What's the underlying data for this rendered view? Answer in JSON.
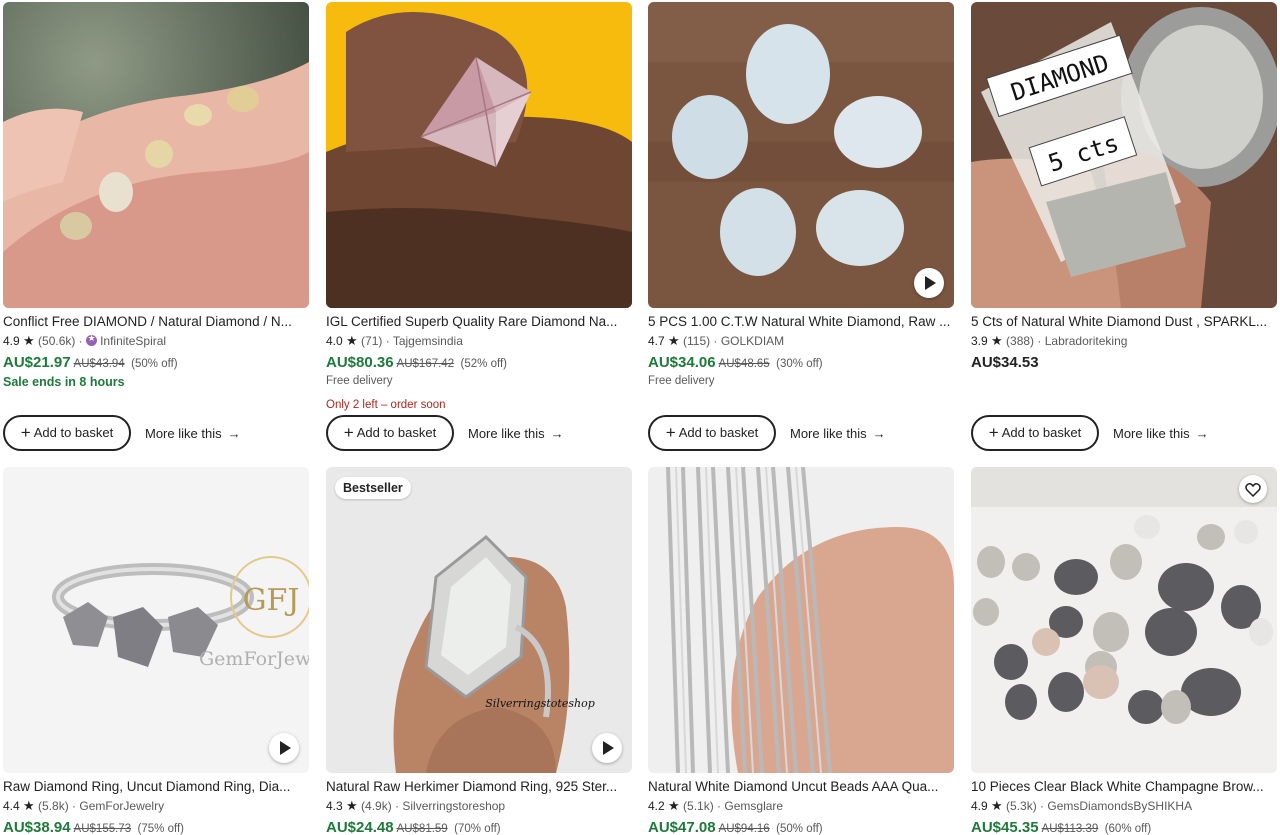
{
  "buttons": {
    "add_to_basket": "Add to basket",
    "more_like_this": "More like this"
  },
  "colors": {
    "price_sale": "#1e7a3a",
    "low_stock": "#b3261e",
    "star_seller": "#9560b8"
  },
  "listings": [
    {
      "title": "Conflict Free DIAMOND / Natural Diamond / N...",
      "rating": "4.9",
      "reviews": "(50.6k)",
      "shop": "InfiniteSpiral",
      "star_seller": true,
      "price": "AU$21.97",
      "original_price": "AU$43.94",
      "discount": "(50% off)",
      "note": "Sale ends in 8 hours"
    },
    {
      "title": "IGL Certified Superb Quality Rare Diamond Na...",
      "rating": "4.0",
      "reviews": "(71)",
      "shop": "Tajgemsindia",
      "price": "AU$80.36",
      "original_price": "AU$167.42",
      "discount": "(52% off)",
      "note": "Free delivery",
      "stock": "Only 2 left – order soon"
    },
    {
      "title": "5 PCS 1.00 C.T.W Natural White Diamond, Raw ...",
      "rating": "4.7",
      "reviews": "(115)",
      "shop": "GOLKDIAM",
      "price": "AU$34.06",
      "original_price": "AU$48.65",
      "discount": "(30% off)",
      "note": "Free delivery",
      "has_video": true
    },
    {
      "title": "5 Cts of Natural White Diamond Dust , SPARKL...",
      "rating": "3.9",
      "reviews": "(388)",
      "shop": "Labradoriteking",
      "price": "AU$34.53",
      "image_text": {
        "line1": "DIAMOND",
        "line2": "5 cts"
      }
    },
    {
      "title": "Raw Diamond Ring, Uncut Diamond Ring, Dia...",
      "rating": "4.4",
      "reviews": "(5.8k)",
      "shop": "GemForJewelry",
      "price": "AU$38.94",
      "original_price": "AU$155.73",
      "discount": "(75% off)",
      "has_video": true,
      "image_text": {
        "logo": "GFJ",
        "watermark": "GemForJew"
      }
    },
    {
      "title": "Natural Raw Herkimer Diamond Ring, 925 Ster...",
      "rating": "4.3",
      "reviews": "(4.9k)",
      "shop": "Silverringstoreshop",
      "price": "AU$24.48",
      "original_price": "AU$81.59",
      "discount": "(70% off)",
      "badge": "Bestseller",
      "has_video": true,
      "image_text": {
        "watermark": "Silverringstoteshop"
      }
    },
    {
      "title": "Natural White Diamond Uncut Beads AAA Qua...",
      "rating": "4.2",
      "reviews": "(5.1k)",
      "shop": "Gemsglare",
      "price": "AU$47.08",
      "original_price": "AU$94.16",
      "discount": "(50% off)"
    },
    {
      "title": "10 Pieces Clear Black White Champagne Brow...",
      "rating": "4.9",
      "reviews": "(5.3k)",
      "shop": "GemsDiamondsBySHIKHA",
      "price": "AU$45.35",
      "original_price": "AU$113.39",
      "discount": "(60% off)",
      "has_favorite": true
    }
  ]
}
